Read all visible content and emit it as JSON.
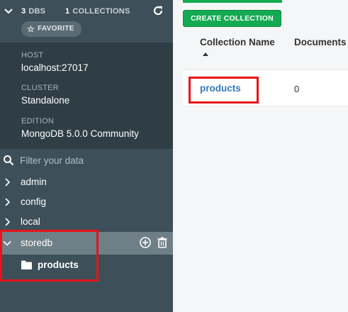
{
  "sidebar": {
    "dbs_count": "3",
    "dbs_label": "DBS",
    "collections_count": "1",
    "collections_label": "COLLECTIONS",
    "favorite_label": "FAVORITE",
    "host_label": "HOST",
    "host_value": "localhost:27017",
    "cluster_label": "CLUSTER",
    "cluster_value": "Standalone",
    "edition_label": "EDITION",
    "edition_value": "MongoDB 5.0.0 Community",
    "filter_placeholder": "Filter your data",
    "databases": [
      {
        "name": "admin"
      },
      {
        "name": "config"
      },
      {
        "name": "local"
      },
      {
        "name": "storedb"
      }
    ],
    "collections": [
      {
        "name": "products"
      }
    ]
  },
  "main": {
    "create_collection_label": "CREATE COLLECTION",
    "columns": [
      "Collection Name",
      "Documents"
    ],
    "rows": [
      {
        "name": "products",
        "documents": "0"
      }
    ]
  },
  "colors": {
    "sidebar_bg": "#3d4f58",
    "info_bg": "#2f3e45",
    "accent_green": "#13aa52",
    "link_blue": "#337ab7",
    "highlight_red": "#e8131a"
  }
}
